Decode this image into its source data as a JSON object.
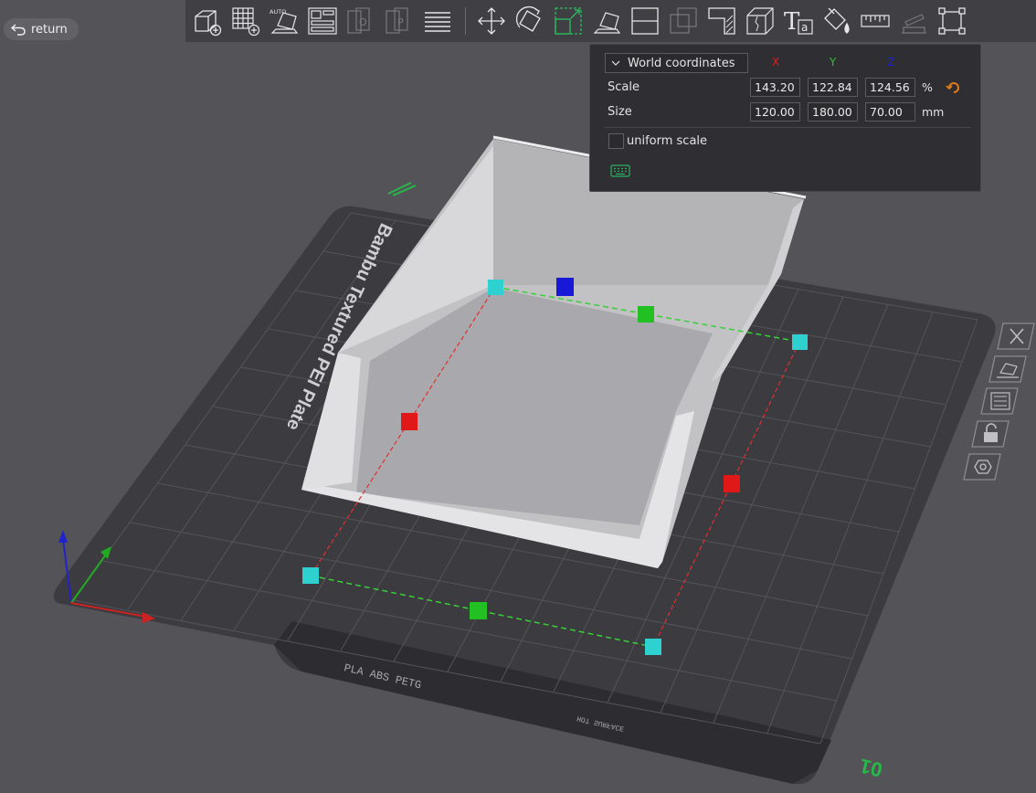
{
  "return_label": "return",
  "toolbar": {
    "items": [
      {
        "name": "add-object-icon"
      },
      {
        "name": "add-plate-icon"
      },
      {
        "name": "auto-orient-icon"
      },
      {
        "name": "arrange-icon"
      },
      {
        "name": "split-objects-icon"
      },
      {
        "name": "split-parts-icon"
      },
      {
        "name": "variable-layer-height-icon"
      },
      {
        "name": "move-icon"
      },
      {
        "name": "rotate-icon"
      },
      {
        "name": "scale-icon"
      },
      {
        "name": "lay-on-face-icon"
      },
      {
        "name": "cut-icon"
      },
      {
        "name": "mesh-boolean-icon"
      },
      {
        "name": "support-paint-icon"
      },
      {
        "name": "seam-paint-icon"
      },
      {
        "name": "text-emboss-icon"
      },
      {
        "name": "color-paint-icon"
      },
      {
        "name": "measure-icon"
      },
      {
        "name": "assembly-icon"
      },
      {
        "name": "fit-view-icon"
      }
    ]
  },
  "scale_panel": {
    "coordinate_system": "World coordinates",
    "axes": {
      "x": "X",
      "y": "Y",
      "z": "Z"
    },
    "axis_colors": {
      "x": "#e02020",
      "y": "#2ec02e",
      "z": "#2020d0"
    },
    "scale": {
      "label": "Scale",
      "x": "143.20",
      "y": "122.84",
      "z": "124.56",
      "unit": "%"
    },
    "size": {
      "label": "Size",
      "x": "120.00",
      "y": "180.00",
      "z": "70.00",
      "unit": "mm"
    },
    "uniform_scale": {
      "label": "uniform scale",
      "checked": false
    },
    "accent_color": "#e07b1a"
  },
  "plate": {
    "name": "Bambu Textured PEI Plate",
    "material_text": "PLA ABS PETG",
    "number": "01",
    "surface_text": "HOT SURFACE"
  },
  "side_toolbar": [
    "delete-icon",
    "orient-icon",
    "arrange-icon",
    "lock-icon",
    "plate-settings-icon"
  ]
}
